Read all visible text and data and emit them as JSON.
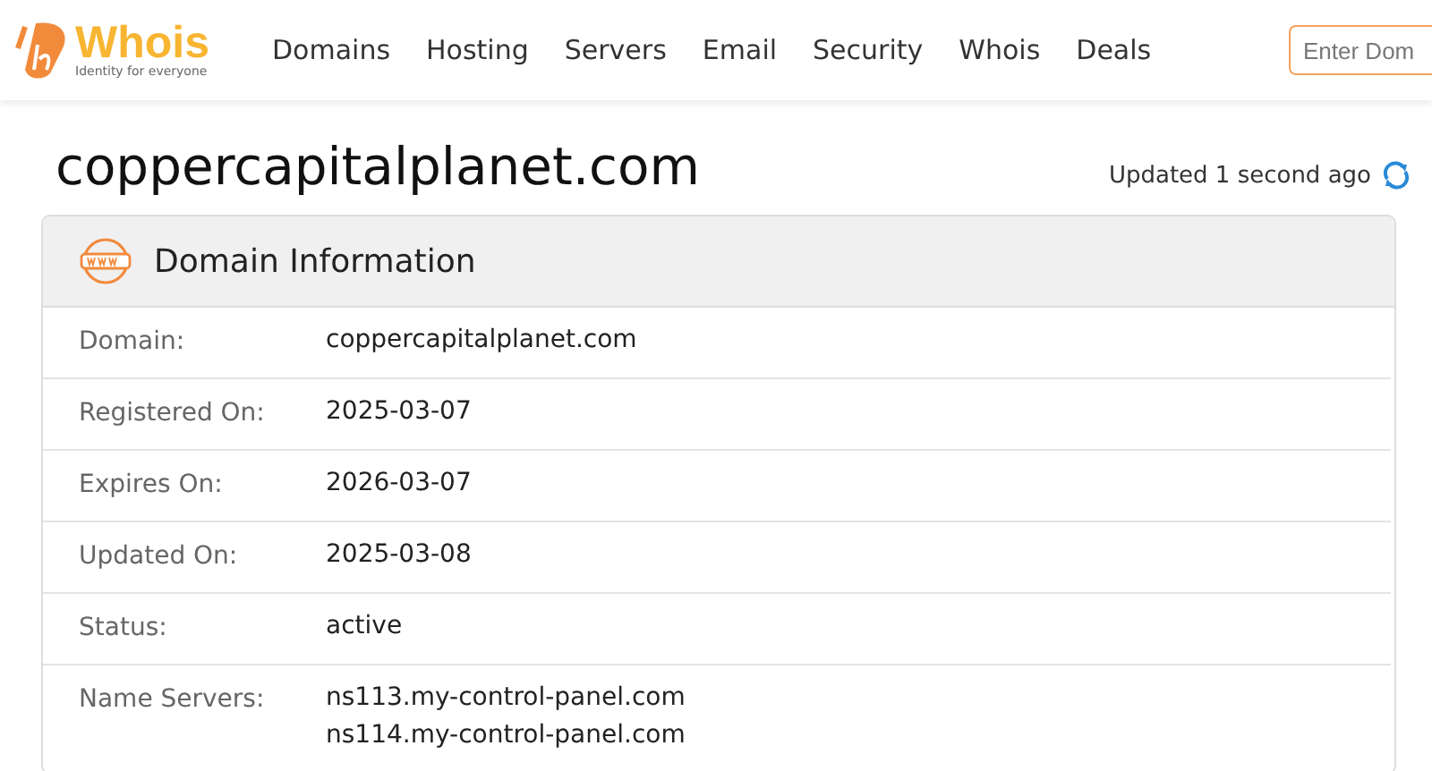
{
  "logo": {
    "name": "Whois",
    "tagline": "Identity for everyone"
  },
  "nav": [
    "Domains",
    "Hosting",
    "Servers",
    "Email",
    "Security",
    "Whois",
    "Deals"
  ],
  "search": {
    "placeholder": "Enter Dom"
  },
  "domain_title": "coppercapitalplanet.com",
  "updated": "Updated 1 second ago",
  "card": {
    "title": "Domain Information",
    "rows": [
      {
        "label": "Domain:",
        "values": [
          "coppercapitalplanet.com"
        ]
      },
      {
        "label": "Registered On:",
        "values": [
          "2025-03-07"
        ]
      },
      {
        "label": "Expires On:",
        "values": [
          "2026-03-07"
        ]
      },
      {
        "label": "Updated On:",
        "values": [
          "2025-03-08"
        ]
      },
      {
        "label": "Status:",
        "values": [
          "active"
        ]
      },
      {
        "label": "Name Servers:",
        "values": [
          "ns113.my-control-panel.com",
          "ns114.my-control-panel.com"
        ]
      }
    ]
  }
}
